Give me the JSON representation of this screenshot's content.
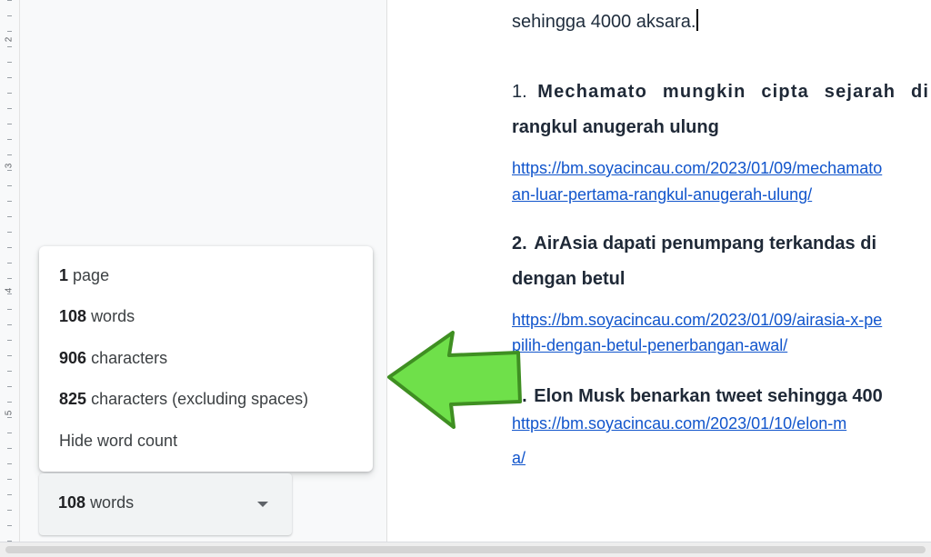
{
  "ruler": {
    "labels": [
      "2",
      "3",
      "4",
      "5"
    ]
  },
  "document": {
    "intro_line": "sehingga 4000 aksara.",
    "items": [
      {
        "number": "1.",
        "title_line1": "Mechamato mungkin cipta sejarah di",
        "title_line2": "rangkul anugerah ulung",
        "link_line1": "https://bm.soyacincau.com/2023/01/09/mechamato",
        "link_line2": "an-luar-pertama-rangkul-anugerah-ulung/"
      },
      {
        "number": "2.",
        "title_line1": "AirAsia dapati penumpang terkandas di",
        "title_line2": "dengan betul",
        "link_line1": "https://bm.soyacincau.com/2023/01/09/airasia-x-pe",
        "link_line2": "pilih-dengan-betul-penerbangan-awal/"
      },
      {
        "number": "3.",
        "title_line1": "Elon Musk benarkan tweet sehingga 400",
        "link_line1": "https://bm.soyacincau.com/2023/01/10/elon-m",
        "link_line2": "a/"
      }
    ]
  },
  "word_count_popup": {
    "pages_count": "1",
    "pages_label": "page",
    "words_count": "108",
    "words_label": "words",
    "chars_count": "906",
    "chars_label": "characters",
    "chars_nospace_count": "825",
    "chars_nospace_label": "characters (excluding spaces)",
    "hide_label": "Hide word count"
  },
  "word_count_button": {
    "count": "108",
    "label": "words"
  },
  "colors": {
    "arrow_fill": "#6fe04a",
    "arrow_stroke": "#3f8f22",
    "link": "#1155cc"
  },
  "icons": {
    "dropdown": "chevron-down-icon",
    "annotation": "left-arrow-icon"
  }
}
